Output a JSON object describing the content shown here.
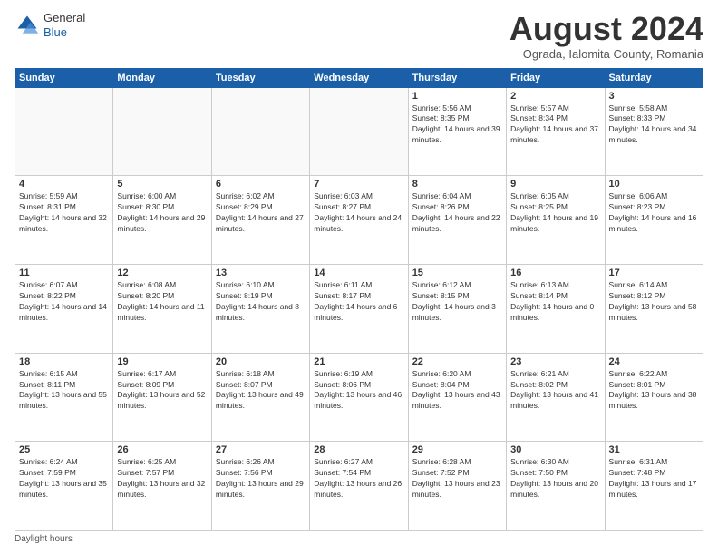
{
  "header": {
    "logo_general": "General",
    "logo_blue": "Blue",
    "month_year": "August 2024",
    "location": "Ograda, Ialomita County, Romania"
  },
  "days_of_week": [
    "Sunday",
    "Monday",
    "Tuesday",
    "Wednesday",
    "Thursday",
    "Friday",
    "Saturday"
  ],
  "weeks": [
    [
      {
        "day": "",
        "info": ""
      },
      {
        "day": "",
        "info": ""
      },
      {
        "day": "",
        "info": ""
      },
      {
        "day": "",
        "info": ""
      },
      {
        "day": "1",
        "info": "Sunrise: 5:56 AM\nSunset: 8:35 PM\nDaylight: 14 hours and 39 minutes."
      },
      {
        "day": "2",
        "info": "Sunrise: 5:57 AM\nSunset: 8:34 PM\nDaylight: 14 hours and 37 minutes."
      },
      {
        "day": "3",
        "info": "Sunrise: 5:58 AM\nSunset: 8:33 PM\nDaylight: 14 hours and 34 minutes."
      }
    ],
    [
      {
        "day": "4",
        "info": "Sunrise: 5:59 AM\nSunset: 8:31 PM\nDaylight: 14 hours and 32 minutes."
      },
      {
        "day": "5",
        "info": "Sunrise: 6:00 AM\nSunset: 8:30 PM\nDaylight: 14 hours and 29 minutes."
      },
      {
        "day": "6",
        "info": "Sunrise: 6:02 AM\nSunset: 8:29 PM\nDaylight: 14 hours and 27 minutes."
      },
      {
        "day": "7",
        "info": "Sunrise: 6:03 AM\nSunset: 8:27 PM\nDaylight: 14 hours and 24 minutes."
      },
      {
        "day": "8",
        "info": "Sunrise: 6:04 AM\nSunset: 8:26 PM\nDaylight: 14 hours and 22 minutes."
      },
      {
        "day": "9",
        "info": "Sunrise: 6:05 AM\nSunset: 8:25 PM\nDaylight: 14 hours and 19 minutes."
      },
      {
        "day": "10",
        "info": "Sunrise: 6:06 AM\nSunset: 8:23 PM\nDaylight: 14 hours and 16 minutes."
      }
    ],
    [
      {
        "day": "11",
        "info": "Sunrise: 6:07 AM\nSunset: 8:22 PM\nDaylight: 14 hours and 14 minutes."
      },
      {
        "day": "12",
        "info": "Sunrise: 6:08 AM\nSunset: 8:20 PM\nDaylight: 14 hours and 11 minutes."
      },
      {
        "day": "13",
        "info": "Sunrise: 6:10 AM\nSunset: 8:19 PM\nDaylight: 14 hours and 8 minutes."
      },
      {
        "day": "14",
        "info": "Sunrise: 6:11 AM\nSunset: 8:17 PM\nDaylight: 14 hours and 6 minutes."
      },
      {
        "day": "15",
        "info": "Sunrise: 6:12 AM\nSunset: 8:15 PM\nDaylight: 14 hours and 3 minutes."
      },
      {
        "day": "16",
        "info": "Sunrise: 6:13 AM\nSunset: 8:14 PM\nDaylight: 14 hours and 0 minutes."
      },
      {
        "day": "17",
        "info": "Sunrise: 6:14 AM\nSunset: 8:12 PM\nDaylight: 13 hours and 58 minutes."
      }
    ],
    [
      {
        "day": "18",
        "info": "Sunrise: 6:15 AM\nSunset: 8:11 PM\nDaylight: 13 hours and 55 minutes."
      },
      {
        "day": "19",
        "info": "Sunrise: 6:17 AM\nSunset: 8:09 PM\nDaylight: 13 hours and 52 minutes."
      },
      {
        "day": "20",
        "info": "Sunrise: 6:18 AM\nSunset: 8:07 PM\nDaylight: 13 hours and 49 minutes."
      },
      {
        "day": "21",
        "info": "Sunrise: 6:19 AM\nSunset: 8:06 PM\nDaylight: 13 hours and 46 minutes."
      },
      {
        "day": "22",
        "info": "Sunrise: 6:20 AM\nSunset: 8:04 PM\nDaylight: 13 hours and 43 minutes."
      },
      {
        "day": "23",
        "info": "Sunrise: 6:21 AM\nSunset: 8:02 PM\nDaylight: 13 hours and 41 minutes."
      },
      {
        "day": "24",
        "info": "Sunrise: 6:22 AM\nSunset: 8:01 PM\nDaylight: 13 hours and 38 minutes."
      }
    ],
    [
      {
        "day": "25",
        "info": "Sunrise: 6:24 AM\nSunset: 7:59 PM\nDaylight: 13 hours and 35 minutes."
      },
      {
        "day": "26",
        "info": "Sunrise: 6:25 AM\nSunset: 7:57 PM\nDaylight: 13 hours and 32 minutes."
      },
      {
        "day": "27",
        "info": "Sunrise: 6:26 AM\nSunset: 7:56 PM\nDaylight: 13 hours and 29 minutes."
      },
      {
        "day": "28",
        "info": "Sunrise: 6:27 AM\nSunset: 7:54 PM\nDaylight: 13 hours and 26 minutes."
      },
      {
        "day": "29",
        "info": "Sunrise: 6:28 AM\nSunset: 7:52 PM\nDaylight: 13 hours and 23 minutes."
      },
      {
        "day": "30",
        "info": "Sunrise: 6:30 AM\nSunset: 7:50 PM\nDaylight: 13 hours and 20 minutes."
      },
      {
        "day": "31",
        "info": "Sunrise: 6:31 AM\nSunset: 7:48 PM\nDaylight: 13 hours and 17 minutes."
      }
    ]
  ],
  "footer": {
    "daylight_hours_label": "Daylight hours"
  }
}
